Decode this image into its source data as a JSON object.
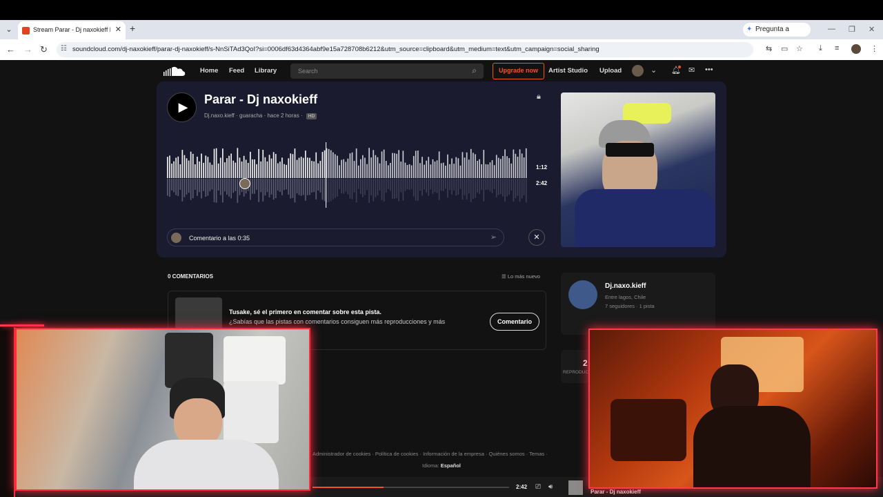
{
  "browser": {
    "tab_title": "Stream Parar - Dj naxokieff by D",
    "new_tab_icon": "+",
    "gemini_label": "Pregunta a Gemini",
    "url": "soundcloud.com/dj-naxokieff/parar-dj-naxokieff/s-NnSiTAd3QoI?si=0006df63d4364abf9e15a728708b6212&utm_source=clipboard&utm_medium=text&utm_campaign=social_sharing"
  },
  "nav": {
    "home": "Home",
    "feed": "Feed",
    "library": "Library",
    "search_placeholder": "Search",
    "upgrade": "Upgrade now",
    "artist_studio": "Artist Studio",
    "upload": "Upload"
  },
  "track": {
    "title": "Parar - Dj naxokieff",
    "artist": "Dj.naxo.kieff",
    "genre": "guaracha",
    "posted": "hace 2 horas",
    "quality_badge": "HD",
    "current_time": "1:12",
    "total_time": "2:42",
    "comment_input": "Comentario a las 0:35"
  },
  "comments": {
    "header": "0 COMENTARIOS",
    "sort_label": "Lo más nuevo",
    "first_heading": "Tusake, sé el primero en comentar sobre esta pista.",
    "first_sub": "¿Sabías que las pistas con comentarios consiguen más reproducciones y más",
    "button": "Comentario"
  },
  "artist_card": {
    "name": "Dj.naxo.kieff",
    "location": "Entre lagos, Chile",
    "followers": "7 seguidores · 1 pista"
  },
  "stats": {
    "plays_num": "2",
    "plays_label": "REPRODUC"
  },
  "footer": {
    "links": "Administrador de cookies  ·  Política de cookies  ·  Información de la empresa  ·  Quiénes somos  ·  Temas  ·",
    "language_label": "Idioma:",
    "language_value": "Español"
  },
  "player": {
    "time": "2:42",
    "progress_fraction": 0.36,
    "title": "Parar - Dj naxokieff"
  },
  "colors": {
    "accent": "#f2561d",
    "stream_overlay": "#ff2a3c"
  }
}
